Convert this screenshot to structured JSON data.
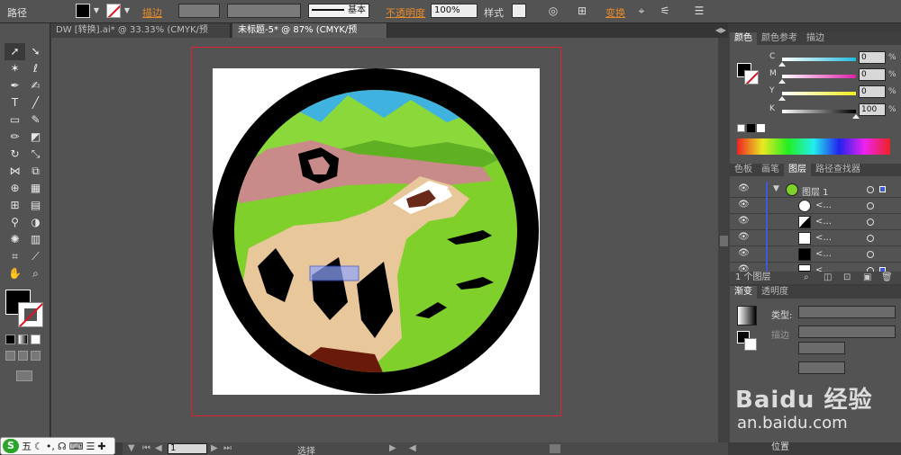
{
  "control_bar": {
    "selection_label": "路径",
    "stroke_label": "描边",
    "stroke_style": "基本",
    "opacity_label": "不透明度",
    "opacity_value": "100%",
    "style_label": "样式",
    "transform_label": "变换"
  },
  "tabs": [
    {
      "label": "DW [转换].ai* @ 33.33% (CMYK/预览)",
      "close": "×"
    },
    {
      "label": "未标题-5* @ 87% (CMYK/预览)",
      "close": "×"
    }
  ],
  "status": {
    "zoom": "87%",
    "page": "1",
    "status_text": "选择"
  },
  "ime": {
    "logo": "S",
    "mode": "五"
  },
  "color_panel": {
    "tabs": [
      "颜色",
      "颜色参考",
      "描边"
    ],
    "channels": [
      {
        "name": "C",
        "value": "0"
      },
      {
        "name": "M",
        "value": "0"
      },
      {
        "name": "Y",
        "value": "0"
      },
      {
        "name": "K",
        "value": "100"
      }
    ],
    "pct": "%"
  },
  "layers_panel": {
    "tabs": [
      "色板",
      "画笔",
      "图层",
      "路径查找器"
    ],
    "layer_name": "图层 1",
    "sublayer_name": "<...",
    "footer": "1 个图层"
  },
  "gradient_panel": {
    "tabs": [
      "渐变",
      "透明度"
    ],
    "type_label": "类型:",
    "stroke_label": "描边",
    "position_label": "位置"
  },
  "watermark": {
    "logo": "Baidu 经验",
    "url": "an.baidu.com"
  },
  "colors": {
    "ui_bg": "#535353",
    "accent_orange": "#e88a2a",
    "artboard_border": "#d22233",
    "ring": "#000000",
    "sky": "#3fb2e0",
    "grass": "#7fd02a",
    "pink_band": "#c98a8a",
    "ferret_tan": "#e8c79a",
    "branch": "#6a1a0a"
  }
}
